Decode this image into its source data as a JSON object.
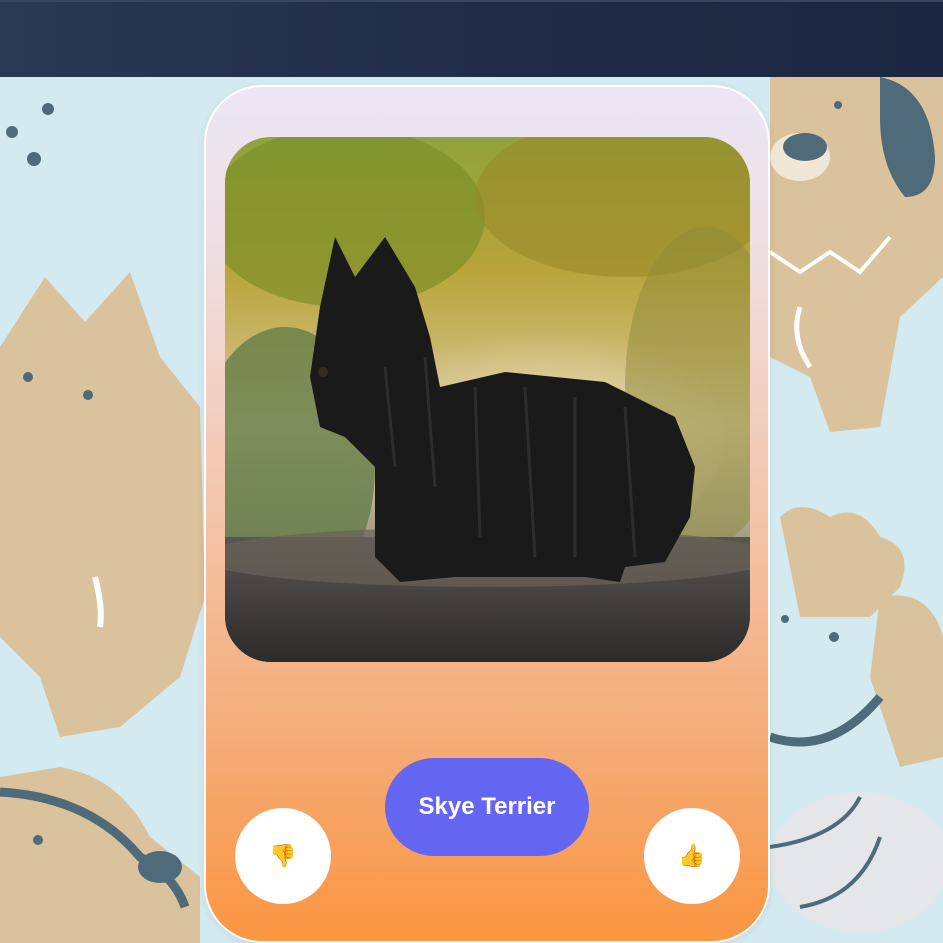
{
  "breed": {
    "name": "Skye Terrier"
  },
  "actions": {
    "dislike_icon": "👎",
    "like_icon": "👍"
  },
  "colors": {
    "top_bar": "#1f2b44",
    "background": "#d4eaf1",
    "breed_button": "#6466f1",
    "card_gradient_top": "#ebe6f6",
    "card_gradient_bottom": "#fb9540"
  },
  "photo": {
    "subject": "black long-haired terrier standing on gravel path"
  }
}
